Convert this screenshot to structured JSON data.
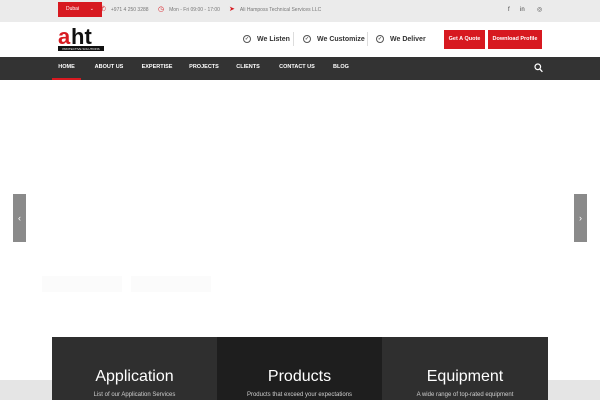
{
  "topbar": {
    "city": "Dubai",
    "phone": "+971 4 250 3288",
    "hours": "Mon - Fri 09:00 - 17:00",
    "company": "Ali Hamposs Technical Services LLC",
    "social": [
      {
        "icon": "facebook-icon",
        "glyph": "f"
      },
      {
        "icon": "linkedin-icon",
        "glyph": "in"
      },
      {
        "icon": "instagram-icon",
        "glyph": "◎"
      }
    ]
  },
  "header": {
    "logo_text": "aht",
    "logo_tagline": "PROTECTIVE SOLUTIONS",
    "values": [
      "We Listen",
      "We Customize",
      "We Deliver"
    ],
    "quote_button": "Get A Quote",
    "profile_button": "Download Profile"
  },
  "nav": {
    "items": [
      "HOME",
      "ABOUT US",
      "EXPERTISE",
      "PROJECTS",
      "CLIENTS",
      "CONTACT US",
      "BLOG"
    ],
    "active_index": 0
  },
  "slider": {
    "prev_glyph": "‹",
    "next_glyph": "›"
  },
  "features": [
    {
      "title": "Application",
      "text": "List of our Application Services"
    },
    {
      "title": "Products",
      "text": "Products that exceed your expectations"
    },
    {
      "title": "Equipment",
      "text": "A wide range of top-rated equipment"
    }
  ],
  "colors": {
    "accent": "#d71920",
    "nav_bg": "#333333",
    "topbar_bg": "#ebebeb",
    "box1_bg": "#2f2f2f",
    "box2_bg": "#1e1e1e",
    "box3_bg": "#2f2f2f"
  }
}
